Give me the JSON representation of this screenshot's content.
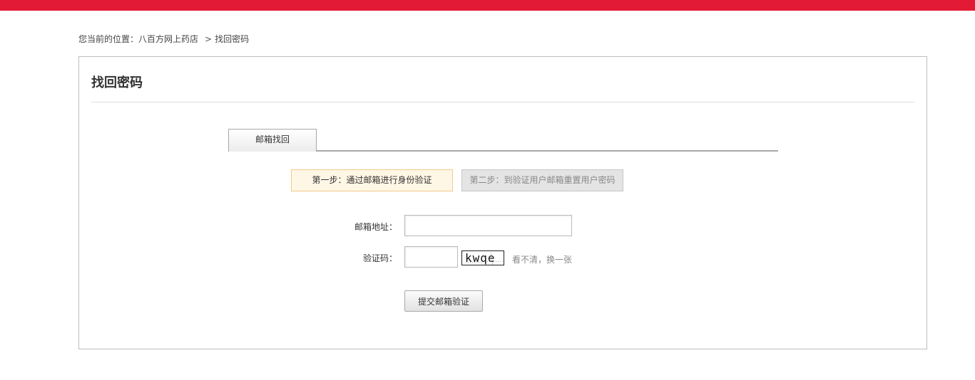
{
  "breadcrumb": {
    "prefix": "您当前的位置：",
    "home": "八百方网上药店",
    "separator": ">",
    "current": "找回密码"
  },
  "panel": {
    "title": "找回密码"
  },
  "tabs": [
    {
      "label": "邮箱找回",
      "active": true
    }
  ],
  "steps": {
    "step1": "第一步：通过邮箱进行身份验证",
    "step2": "第二步：到验证用户邮箱重置用户密码"
  },
  "form": {
    "email_label": "邮箱地址：",
    "email_value": "",
    "code_label": "验证码：",
    "code_value": "",
    "captcha_text": "kwqe",
    "refresh_label": "看不清，换一张",
    "submit_label": "提交邮箱验证"
  },
  "colors": {
    "topbar": "#e31a35",
    "step1_bg": "#fff7e5",
    "step1_border": "#f2c98a",
    "step2_bg": "#e4e4e4"
  }
}
